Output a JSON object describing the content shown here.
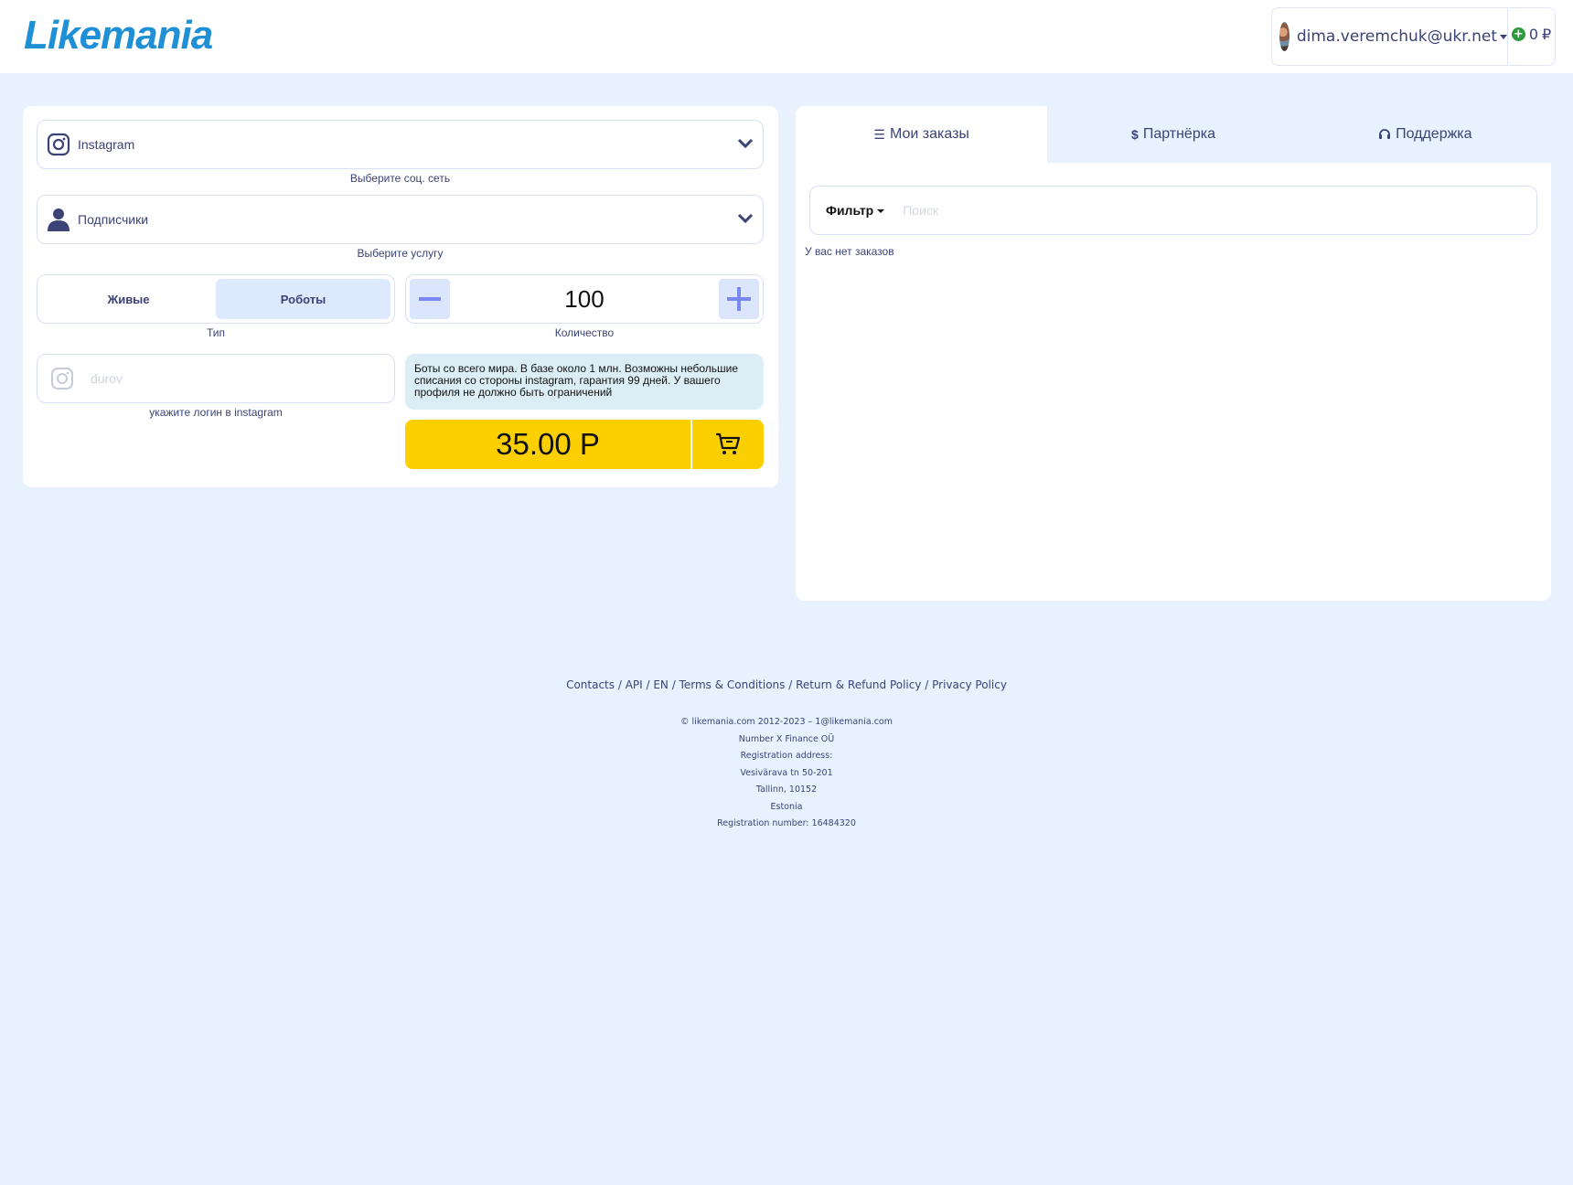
{
  "header": {
    "logo": "Likemania",
    "user_email": "dima.veremchuk@ukr.net",
    "balance": "0",
    "currency": "₽"
  },
  "order_form": {
    "network": {
      "value": "Instagram",
      "hint": "Выберите соц. сеть"
    },
    "service": {
      "value": "Подписчики",
      "hint": "Выберите услугу"
    },
    "type": {
      "options": [
        "Живые",
        "Роботы"
      ],
      "selected": "Роботы",
      "hint": "Тип"
    },
    "quantity": {
      "value": "100",
      "hint": "Количество"
    },
    "login": {
      "placeholder": "durov",
      "hint": "укажите логин в instagram"
    },
    "info_text": "Боты со всего мира. В базе около 1 млн. Возможны небольшие списания со стороны instagram, гарантия 99 дней. У вашего профиля не должно быть ограничений",
    "price": "35.00 Р"
  },
  "orders_panel": {
    "tabs": [
      {
        "label": "Мои заказы",
        "icon": "list-icon",
        "active": true
      },
      {
        "label": "Партнёрка",
        "icon": "dollar-icon",
        "active": false
      },
      {
        "label": "Поддержка",
        "icon": "headset-icon",
        "active": false
      }
    ],
    "filter_label": "Фильтр",
    "search_placeholder": "Поиск",
    "empty_message": "У вас нет заказов"
  },
  "footer": {
    "links": [
      "Contacts",
      "API",
      "EN",
      "Terms & Conditions",
      "Return & Refund Policy",
      "Privacy Policy"
    ],
    "info_lines": [
      "© likemania.com 2012-2023 – 1@likemania.com",
      "Number X Finance OÜ",
      "Registration address:",
      "Vesivärava tn 50-201",
      "Tallinn, 10152",
      "Estonia",
      "Registration number: 16484320"
    ]
  },
  "colors": {
    "background": "#e8f1fe",
    "accent_text": "#3b4377",
    "logo": "#1f8fd6",
    "price_button": "#fcd000",
    "info_box": "#dbeef5",
    "active_toggle": "#dde9fd"
  }
}
